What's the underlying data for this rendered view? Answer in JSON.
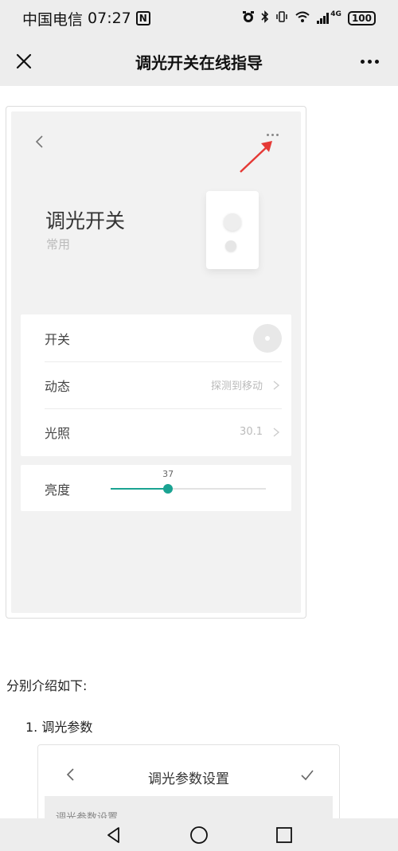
{
  "status_bar": {
    "carrier": "中国电信",
    "time": "07:27",
    "nfc": "N",
    "network": "4G",
    "battery": "100"
  },
  "title_bar": {
    "title": "调光开关在线指导"
  },
  "device_screen": {
    "device_name": "调光开关",
    "device_subtitle": "常用",
    "rows": [
      {
        "label": "开关"
      },
      {
        "label": "动态",
        "value": "探测到移动"
      },
      {
        "label": "光照",
        "value": "30.1"
      }
    ],
    "brightness": {
      "label": "亮度",
      "value": 37,
      "value_label": "37"
    },
    "colors": {
      "accent": "#1aa392",
      "annotation_arrow": "#e53935"
    }
  },
  "article": {
    "intro": "分别介绍如下:",
    "list_item_1": "1. 调光参数"
  },
  "settings_screen": {
    "title": "调光参数设置",
    "section_header": "调光参数设置"
  },
  "icons": {
    "close": "close-icon",
    "more": "more-icon",
    "back": "chevron-left-icon",
    "chevron": "chevron-right-icon",
    "check": "check-icon",
    "nav_back": "triangle-back-icon",
    "nav_home": "circle-home-icon",
    "nav_recent": "square-recent-icon"
  }
}
